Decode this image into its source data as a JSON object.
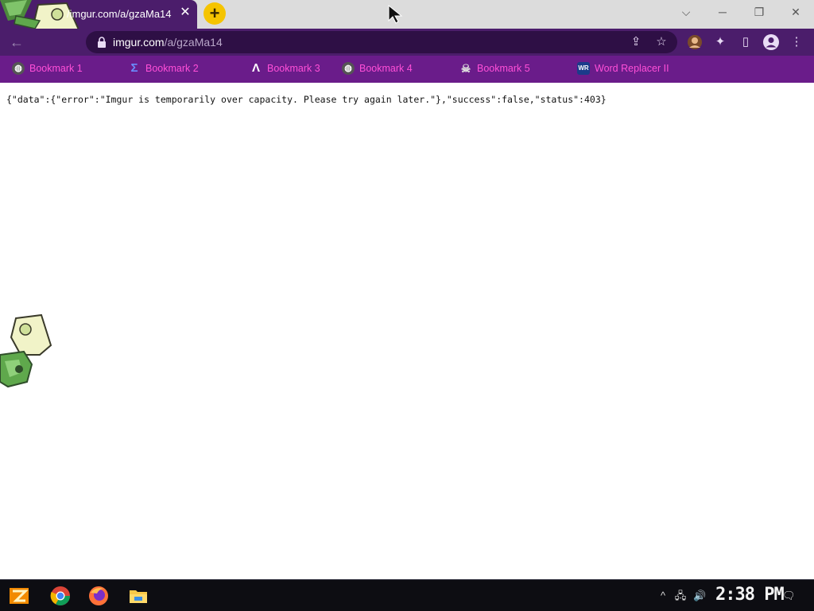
{
  "tab": {
    "title": "/imgur.com/a/gzaMa14",
    "close_glyph": "✕"
  },
  "new_tab_glyph": "+",
  "window_controls": {
    "tabs_search": "⌵",
    "minimize": "─",
    "restore": "❐",
    "close": "✕"
  },
  "toolbar": {
    "back_glyph": "←",
    "url_host": "imgur.com",
    "url_path": "/a/gzaMa14",
    "share_glyph": "⇪",
    "star_glyph": "☆",
    "extensions_glyph": "✦",
    "sidepanel_glyph": "▯",
    "menu_glyph": "⋮"
  },
  "bookmarks": [
    {
      "icon": "globe-icon",
      "glyph": "🌐",
      "label": "Bookmark 1"
    },
    {
      "icon": "bracket-icon",
      "glyph": "Σ",
      "label": "Bookmark 2"
    },
    {
      "icon": "lambda-icon",
      "glyph": "Λ",
      "label": "Bookmark 3"
    },
    {
      "icon": "globe-icon",
      "glyph": "🌐",
      "label": "Bookmark 4"
    },
    {
      "icon": "ghost-icon",
      "glyph": "☠",
      "label": "Bookmark 5"
    },
    {
      "icon": "wr-icon",
      "glyph": "WR",
      "label": "Word Replacer II"
    }
  ],
  "page": {
    "json_text": "{\"data\":{\"error\":\"Imgur is temporarily over capacity. Please try again later.\"},\"success\":false,\"status\":403}"
  },
  "taskbar": {
    "apps": [
      "start-icon",
      "chrome-icon",
      "firefox-icon",
      "file-explorer-icon"
    ],
    "tray": {
      "chevron": "^",
      "network": "🖧",
      "volume": "🔊",
      "notification": "🗨"
    },
    "clock": "2:38 PM"
  },
  "colors": {
    "theme_purple": "#4b1d6b",
    "bookmarks_bar": "#6a1c8a",
    "bookmark_text": "#ff4fd8",
    "new_tab_yellow": "#f5c400"
  }
}
